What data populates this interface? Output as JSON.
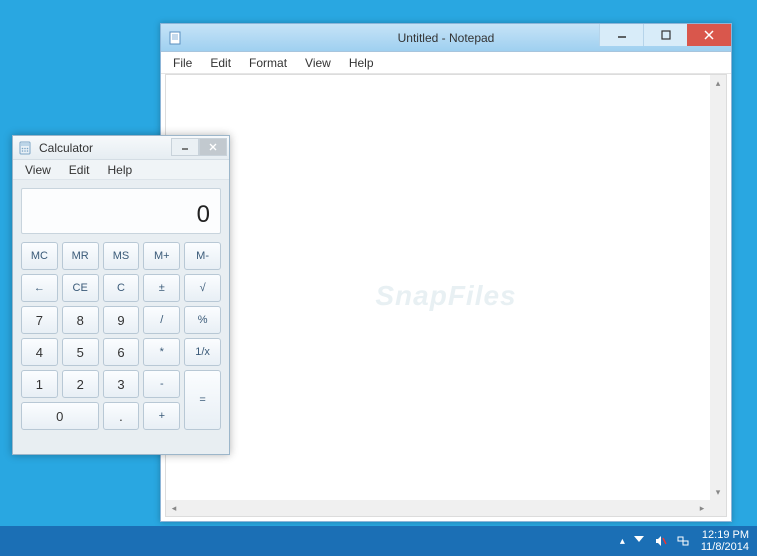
{
  "notepad": {
    "title": "Untitled - Notepad",
    "menu": [
      "File",
      "Edit",
      "Format",
      "View",
      "Help"
    ],
    "watermark": "SnapFiles"
  },
  "calculator": {
    "title": "Calculator",
    "menu": [
      "View",
      "Edit",
      "Help"
    ],
    "display": "0",
    "buttons": {
      "mc": "MC",
      "mr": "MR",
      "ms": "MS",
      "mplus": "M+",
      "mminus": "M-",
      "back": "←",
      "ce": "CE",
      "c": "C",
      "pm": "±",
      "sqrt": "√",
      "n7": "7",
      "n8": "8",
      "n9": "9",
      "div": "/",
      "pct": "%",
      "n4": "4",
      "n5": "5",
      "n6": "6",
      "mul": "*",
      "recip": "1/x",
      "n1": "1",
      "n2": "2",
      "n3": "3",
      "sub": "-",
      "eq": "=",
      "n0": "0",
      "dot": ".",
      "add": "+"
    }
  },
  "taskbar": {
    "time": "12:19 PM",
    "date": "11/8/2014"
  }
}
